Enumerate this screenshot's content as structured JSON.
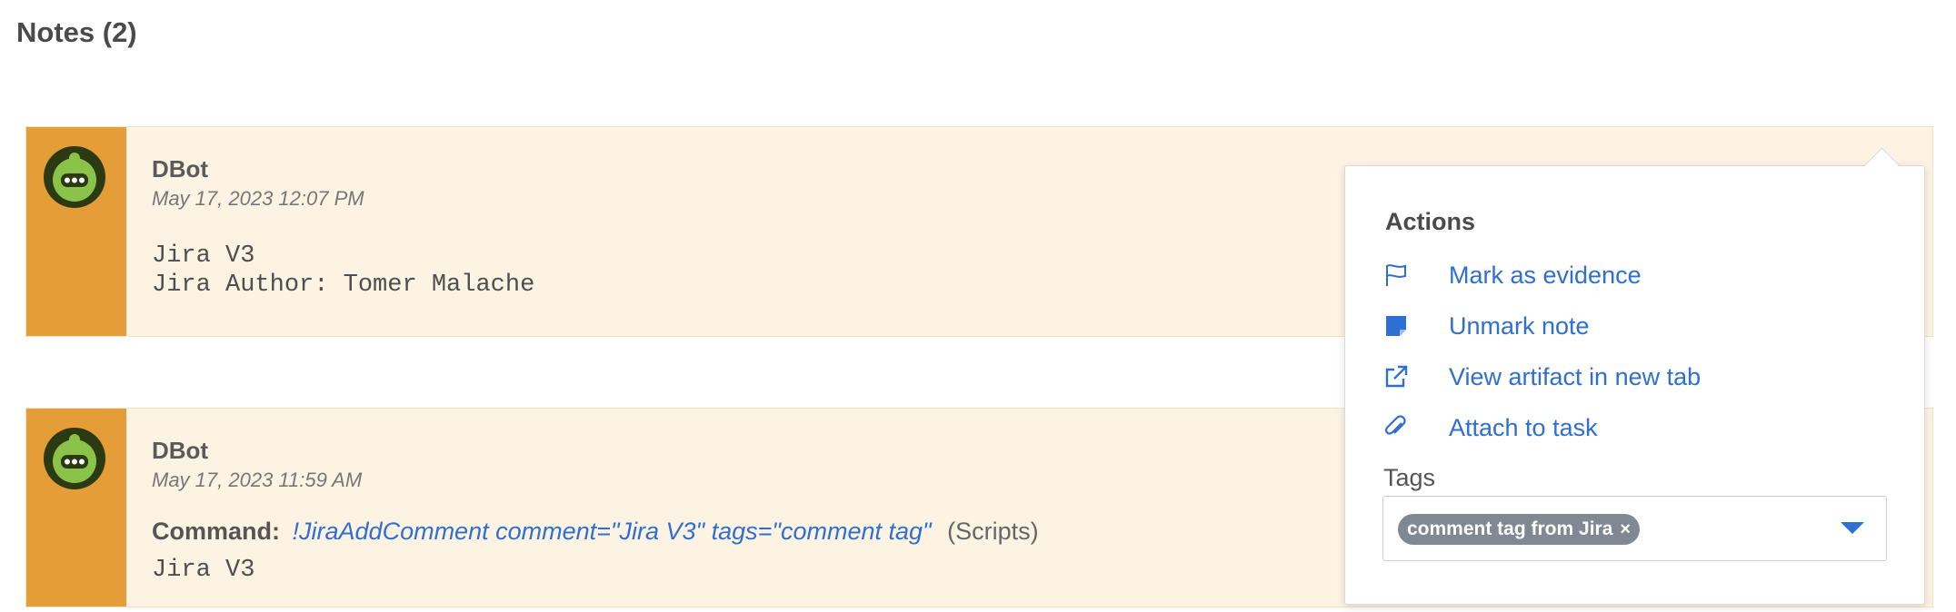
{
  "section": {
    "title": "Notes (2)"
  },
  "notes": [
    {
      "author": "DBot",
      "timestamp": "May 17, 2023 12:07 PM",
      "lines": [
        "Jira V3",
        "Jira Author: Tomer Malache"
      ]
    },
    {
      "author": "DBot",
      "timestamp": "May 17, 2023 11:59 AM",
      "command_label": "Command:",
      "command_text": "!JiraAddComment comment=\"Jira V3\" tags=\"comment tag\"",
      "command_suffix": "(Scripts)",
      "lines": [
        "Jira V3"
      ]
    }
  ],
  "popover": {
    "heading": "Actions",
    "actions": [
      {
        "label": "Mark as evidence",
        "icon": "flag-icon"
      },
      {
        "label": "Unmark note",
        "icon": "note-icon"
      },
      {
        "label": "View artifact in new tab",
        "icon": "external-link-icon"
      },
      {
        "label": "Attach to task",
        "icon": "paperclip-icon"
      }
    ],
    "tags_label": "Tags",
    "tags": [
      "comment tag from Jira"
    ],
    "tag_remove": "×"
  },
  "colors": {
    "gutter": "#e49d37",
    "note_bg": "#fdf3e2",
    "link": "#2e6fd1",
    "chip": "#808893"
  }
}
